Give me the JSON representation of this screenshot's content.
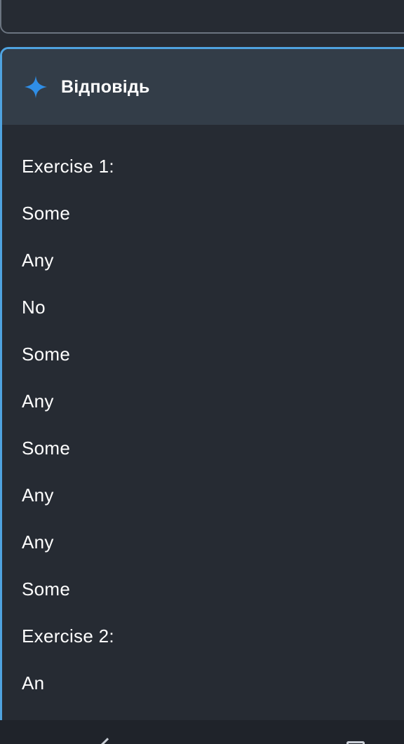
{
  "answer": {
    "title": "Відповідь",
    "icon": "sparkle-icon",
    "accent_color": "#4fa3e0",
    "lines": [
      "Exercise 1:",
      "Some",
      "Any",
      "No",
      "Some",
      "Any",
      "Some",
      "Any",
      "Any",
      "Some",
      "Exercise 2:",
      "An"
    ]
  },
  "nav": {
    "back_icon": "back-icon",
    "recents_icon": "recents-icon"
  }
}
